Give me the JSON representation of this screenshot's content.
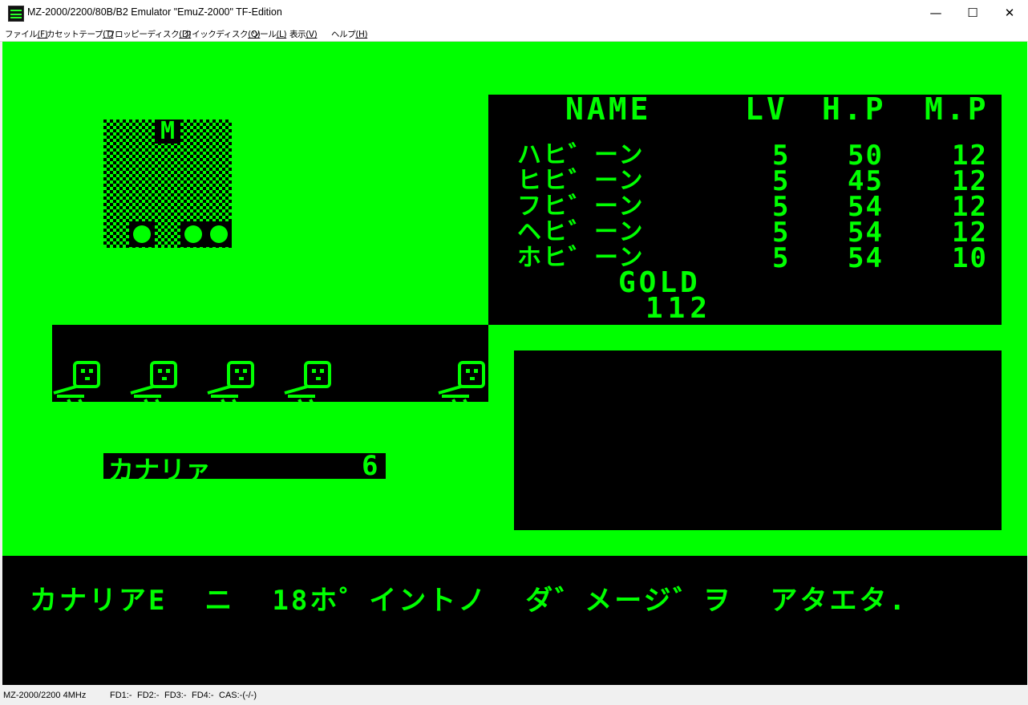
{
  "window": {
    "title": "MZ-2000/2200/80B/B2 Emulator \"EmuZ-2000\" TF-Edition",
    "minimize": "—",
    "maximize": "☐",
    "close": "✕"
  },
  "menu": {
    "items": [
      {
        "label": "ファイル",
        "key": "(F)"
      },
      {
        "label": "カセットテープ",
        "key": "(T)"
      },
      {
        "label": "フロッピーディスク",
        "key": "(D)"
      },
      {
        "label": "クイックディスク",
        "key": "(Q)"
      },
      {
        "label": "ツール",
        "key": "(L)"
      },
      {
        "label": "表示",
        "key": "(V)"
      },
      {
        "label": "ヘルプ",
        "key": "(H)"
      }
    ]
  },
  "map": {
    "marker": "M"
  },
  "party": {
    "headers": {
      "name": "NAME",
      "lv": "LV",
      "hp": "H.P",
      "mp": "M.P"
    },
    "members": [
      {
        "name": "ハヒ゛ーン",
        "lv": "5",
        "hp": "50",
        "mp": "12"
      },
      {
        "name": "ヒヒ゛ーン",
        "lv": "5",
        "hp": "45",
        "mp": "12"
      },
      {
        "name": "フヒ゛ーン",
        "lv": "5",
        "hp": "54",
        "mp": "12"
      },
      {
        "name": "ヘヒ゛ーン",
        "lv": "5",
        "hp": "54",
        "mp": "12"
      },
      {
        "name": "ホヒ゛ーン",
        "lv": "5",
        "hp": "54",
        "mp": "10"
      }
    ],
    "gold_label": "GOLD",
    "gold_value": "112"
  },
  "enemy": {
    "name": "カナリァ",
    "count": "6"
  },
  "message": "カナリアE  ニ  18ホ゜イントノ  ダ゛メージ゛ヲ  アタエタ.",
  "statusbar": {
    "cpu": "MZ-2000/2200 4MHz",
    "fd1": "FD1:-",
    "fd2": "FD2:-",
    "fd3": "FD3:-",
    "fd4": "FD4:-",
    "cas": "CAS:-(-/-)"
  },
  "colors": {
    "screen_green": "#00ff00",
    "screen_black": "#000000"
  }
}
